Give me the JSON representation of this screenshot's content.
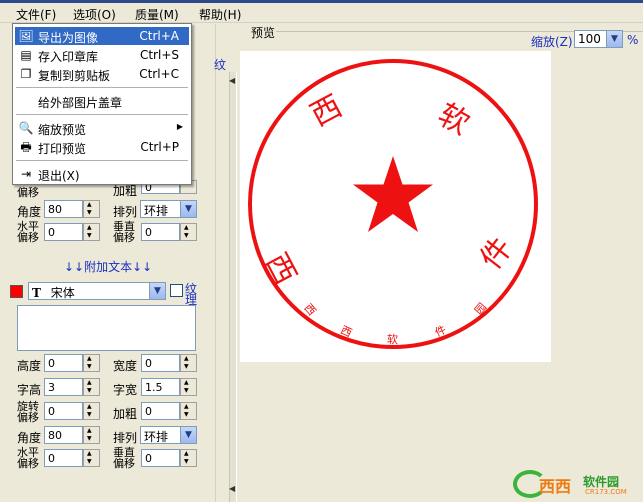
{
  "menubar": {
    "items": [
      "文件(F)",
      "选项(O)",
      "质量(M)",
      "帮助(H)"
    ]
  },
  "file_menu": {
    "items": [
      {
        "label": "导出为图像",
        "shortcut": "Ctrl+A",
        "icon": "export-image-icon",
        "highlighted": true
      },
      {
        "label": "存入印章库",
        "shortcut": "Ctrl+S",
        "icon": "save-library-icon"
      },
      {
        "label": "复制到剪贴板",
        "shortcut": "Ctrl+C",
        "icon": "copy-icon"
      },
      {
        "label": "给外部图片盖章",
        "shortcut": "",
        "icon": ""
      },
      {
        "label": "缩放预览",
        "shortcut": "",
        "icon": "zoom-preview-icon",
        "submenu": true
      },
      {
        "label": "打印预览",
        "shortcut": "Ctrl+P",
        "icon": "print-preview-icon"
      },
      {
        "label": "退出(X)",
        "shortcut": "",
        "icon": "exit-icon"
      }
    ]
  },
  "upper_form": {
    "offset_label": "偏移",
    "bold_label": "加粗",
    "bold_value": "0",
    "angle_label": "角度",
    "angle_value": "80",
    "arrange_label": "排列",
    "arrange_value": "环排",
    "hoffset_label_1": "水平",
    "hoffset_label_2": "偏移",
    "hoffset_value": "0",
    "voffset_label_1": "垂直",
    "voffset_label_2": "偏移",
    "voffset_value": "0",
    "texture_partial": "纹"
  },
  "additional_text": {
    "title": "↓↓附加文本↓↓",
    "color": "#ff0000",
    "font": "宋体",
    "texture_label_1": "纹",
    "texture_label_2": "理",
    "texture_checked": false,
    "text_value": "",
    "height_label": "高度",
    "height_value": "0",
    "width_label": "宽度",
    "width_value": "0",
    "char_height_label": "字高",
    "char_height_value": "3",
    "char_width_label": "字宽",
    "char_width_value": "1.5",
    "rotate_label_1": "旋转",
    "rotate_label_2": "偏移",
    "rotate_value": "0",
    "bold_label": "加粗",
    "bold_value": "0",
    "angle_label": "角度",
    "angle_value": "80",
    "arrange_label": "排列",
    "arrange_value": "环排",
    "hoffset_label_1": "水平",
    "hoffset_label_2": "偏移",
    "hoffset_value": "0",
    "voffset_label_1": "垂直",
    "voffset_label_2": "偏移",
    "voffset_value": "0"
  },
  "preview": {
    "label": "预览",
    "zoom_label": "缩放(Z)",
    "zoom_value": "100",
    "zoom_unit": "%",
    "seal_color": "#ee1111",
    "top_text": [
      "西",
      "软"
    ],
    "bottom_text": [
      "西",
      "件"
    ],
    "small_text": [
      "西",
      "西",
      "软",
      "件",
      "园"
    ]
  },
  "watermark": {
    "brand": "西西软件园",
    "brand_first": "西西",
    "brand_rest": "软件园",
    "url": "CR173.COM"
  }
}
